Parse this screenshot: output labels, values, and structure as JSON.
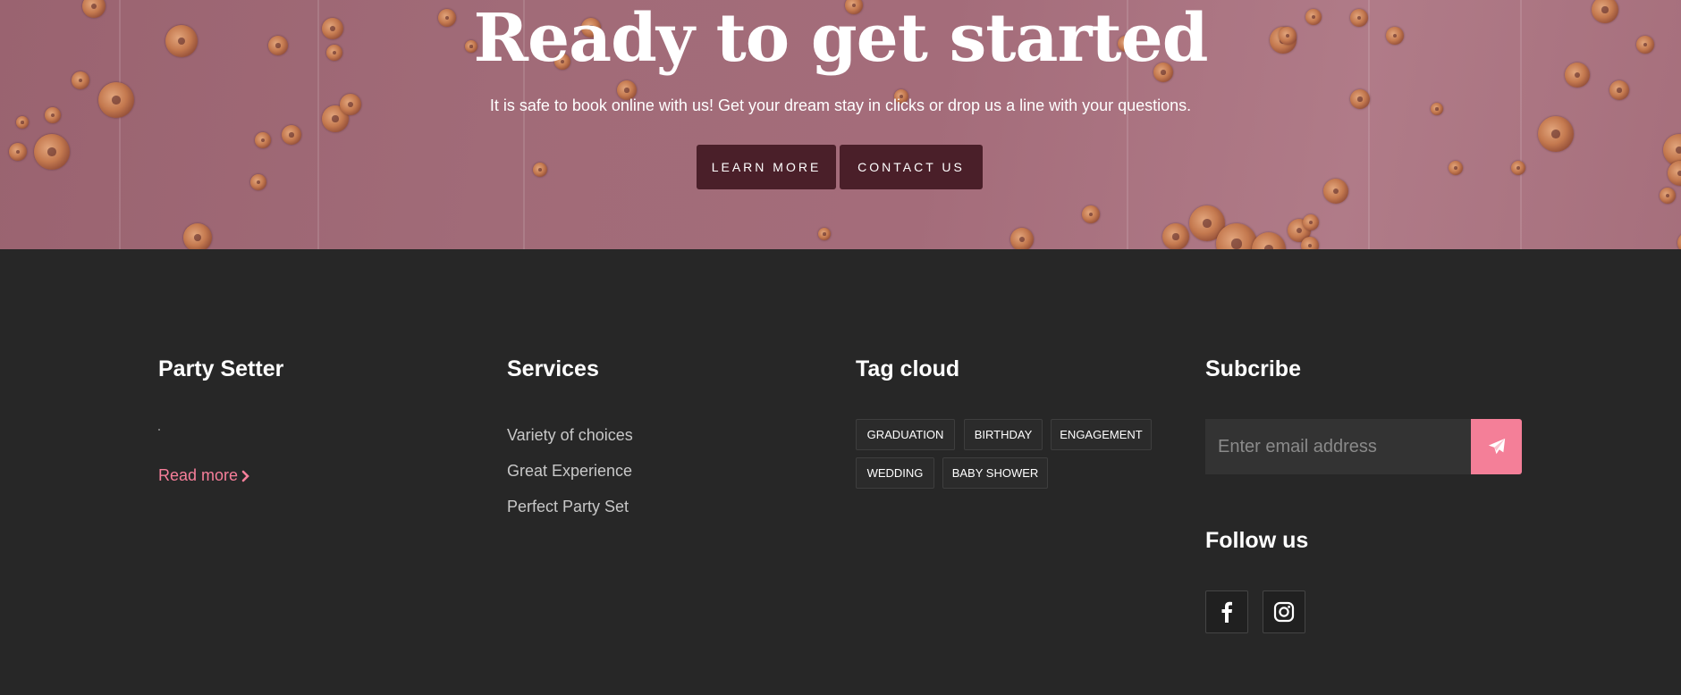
{
  "hero": {
    "title": "Ready to get started",
    "subtitle": "It is safe to book online with us! Get your dream stay in clicks or drop us a line with your questions.",
    "buttons": {
      "learn_more": "LEARN MORE",
      "contact_us": "CONTACT US"
    },
    "button_color": "#4a1f29"
  },
  "footer": {
    "about": {
      "title": "Party Setter",
      "read_more": "Read more"
    },
    "services": {
      "title": "Services",
      "items": [
        "Variety of choices",
        "Great Experience",
        "Perfect Party Set"
      ]
    },
    "tags": {
      "title": "Tag cloud",
      "items": [
        "GRADUATION",
        "BIRTHDAY",
        "ENGAGEMENT",
        "WEDDING",
        "BABY SHOWER"
      ]
    },
    "subscribe": {
      "title": "Subcribe",
      "placeholder": "Enter email address",
      "submit_icon": "paper-plane-icon"
    },
    "follow": {
      "title": "Follow us",
      "icons": [
        "facebook-icon",
        "instagram-icon"
      ]
    },
    "accent_color": "#f47f98",
    "background_color": "#272727"
  }
}
